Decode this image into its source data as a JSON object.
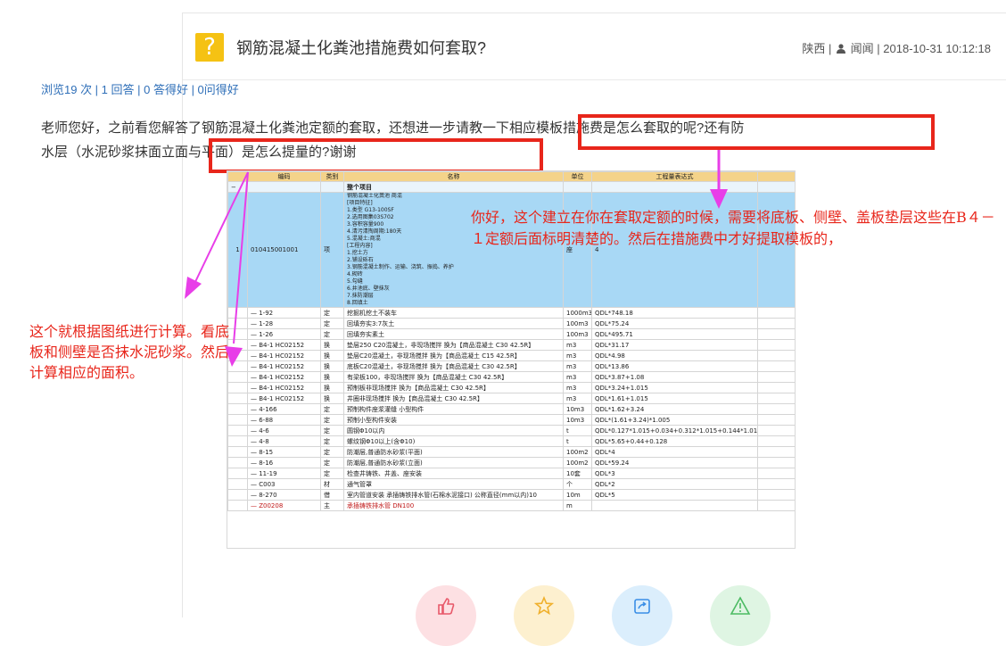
{
  "question": {
    "title": "钢筋混凝土化粪池措施费如何套取?",
    "region": "陕西",
    "author": "闻闻",
    "datetime": "2018-10-31 10:12:18",
    "icon": "question-mark-icon"
  },
  "stats": {
    "text": "浏览19 次 | 1 回答 | 0 答得好 | 0问得好"
  },
  "body": {
    "part1": "老师您好，之前看您解答了钢筋混凝土化粪池定额的套取，",
    "part2_boxed": "还想进一步请教一下相应模板措施费是怎么套取的呢?",
    "part3": "还有防",
    "part4_boxed": "水层（水泥砂浆抹面立面与平面）是怎么提量的?",
    "part5": "谢谢"
  },
  "annotations": {
    "blue_area": "你好，这个建立在你在套取定额的时候，需要将底板、侧壁、盖板垫层这些在B４－１定额后面标明清楚的。然后在措施费中才好提取模板的，",
    "left": "这个就根据图纸进行计算。看底板和侧壁是否抹水泥砂浆。然后计算相应的面积。"
  },
  "table": {
    "headers": [
      "",
      "编码",
      "类别",
      "名称",
      "单位",
      "工程量表达式"
    ],
    "top_row_name": "整个项目",
    "main_row": {
      "index": "1",
      "code": "010415001001",
      "type": "项",
      "unit": "座",
      "qty": "4",
      "desc_lines": [
        "钢筋混凝土化粪池  商混",
        "[项目特征]",
        "1.类型 G13-100SF",
        "2.选用图集03S702",
        "3.容积容量900",
        "4.清污清掏周期:180天",
        "5.混凝土:商混",
        "[工程内容]",
        "1.挖土方",
        "2.铺设砾石",
        "3.钢筋混凝土制作、运输、浇筑、振捣、养护",
        "4.砌砖",
        "5.勾缝",
        "6.井池底、壁抹灰",
        "7.抹防潮层",
        "8.回填土"
      ]
    },
    "rows": [
      {
        "code": "1-92",
        "type": "定",
        "name": "挖掘机挖土不装车",
        "unit": "1000m3",
        "expr": "QDL*748.18"
      },
      {
        "code": "1-28",
        "type": "定",
        "name": "回填夯实3:7灰土",
        "unit": "100m3",
        "expr": "QDL*75.24"
      },
      {
        "code": "1-26",
        "type": "定",
        "name": "回填夯实素土",
        "unit": "100m3",
        "expr": "QDL*495.71"
      },
      {
        "code": "B4-1 HC02152",
        "type": "换",
        "name": "垫层250 C20混凝土，非现场搅拌 换为【商品混凝土 C30  42.5R】",
        "unit": "m3",
        "expr": "QDL*31.17"
      },
      {
        "code": "B4-1 HC02152",
        "type": "换",
        "name": "垫层C20混凝土，非现场搅拌 换为【商品混凝土 C15  42.5R】",
        "unit": "m3",
        "expr": "QDL*4.98"
      },
      {
        "code": "B4-1 HC02152",
        "type": "换",
        "name": "底板C20混凝土，非现场搅拌 换为【商品混凝土 C30  42.5R】",
        "unit": "m3",
        "expr": "QDL*13.86"
      },
      {
        "code": "B4-1 HC02152",
        "type": "换",
        "name": "有梁板100，非现场搅拌 换为【商品混凝土 C30  42.5R】",
        "unit": "m3",
        "expr": "QDL*3.87+1.08"
      },
      {
        "code": "B4-1 HC02152",
        "type": "换",
        "name": "预制板非现场搅拌 换为【商品混凝土 C30  42.5R】",
        "unit": "m3",
        "expr": "QDL*3.24+1.015"
      },
      {
        "code": "B4-1 HC02152",
        "type": "换",
        "name": "井圈非现场搅拌 换为【商品混凝土 C30  42.5R】",
        "unit": "m3",
        "expr": "QDL*1.61+1.015"
      },
      {
        "code": "4-166",
        "type": "定",
        "name": "预制构件座浆灌缝 小型构件",
        "unit": "10m3",
        "expr": "QDL*1.62+3.24"
      },
      {
        "code": "6-88",
        "type": "定",
        "name": "预制小型构件安装",
        "unit": "10m3",
        "expr": "QDL*(1.61+3.24)*1.005"
      },
      {
        "code": "4-6",
        "type": "定",
        "name": "圆钢Φ10以内",
        "unit": "t",
        "expr": "QDL*0.127*1.015+0.034+0.312*1.015+0.144*1.015"
      },
      {
        "code": "4-8",
        "type": "定",
        "name": "螺纹钢Φ10以上(含Φ10)",
        "unit": "t",
        "expr": "QDL*5.65+0.44+0.128"
      },
      {
        "code": "8-15",
        "type": "定",
        "name": "防潮层,普通防水砂浆(平面)",
        "unit": "100m2",
        "expr": "QDL*4"
      },
      {
        "code": "8-16",
        "type": "定",
        "name": "防潮层,普通防水砂浆(立面)",
        "unit": "100m2",
        "expr": "QDL*59.24"
      },
      {
        "code": "11-19",
        "type": "定",
        "name": "检查井铸铁、井盖、座安装",
        "unit": "10套",
        "expr": "QDL*3"
      },
      {
        "code": "C003",
        "type": "材",
        "name": "通气管罩",
        "unit": "个",
        "expr": "QDL*2"
      },
      {
        "code": "8-270",
        "type": "借",
        "name": "室内管道安装 承插铸铁排水管(石棉水泥接口) 公称直径(mm以内)10",
        "unit": "10m",
        "expr": "QDL*5"
      },
      {
        "code": "Z00208",
        "type": "主",
        "name": "承插铸铁排水管 DN100",
        "unit": "m",
        "expr": ""
      }
    ]
  },
  "actions": [
    {
      "name": "thumbs-up-icon",
      "color": "#fde0e3"
    },
    {
      "name": "star-icon",
      "color": "#fdf0cf"
    },
    {
      "name": "share-icon",
      "color": "#dbeefc"
    },
    {
      "name": "warning-icon",
      "color": "#dff5e3"
    }
  ],
  "colors": {
    "accent_red": "#e8261b",
    "link_blue": "#2f6fb8",
    "magenta_arrow": "#e83ee8",
    "icon_yellow": "#f5c213",
    "row_highlight": "#a8d8f5"
  }
}
